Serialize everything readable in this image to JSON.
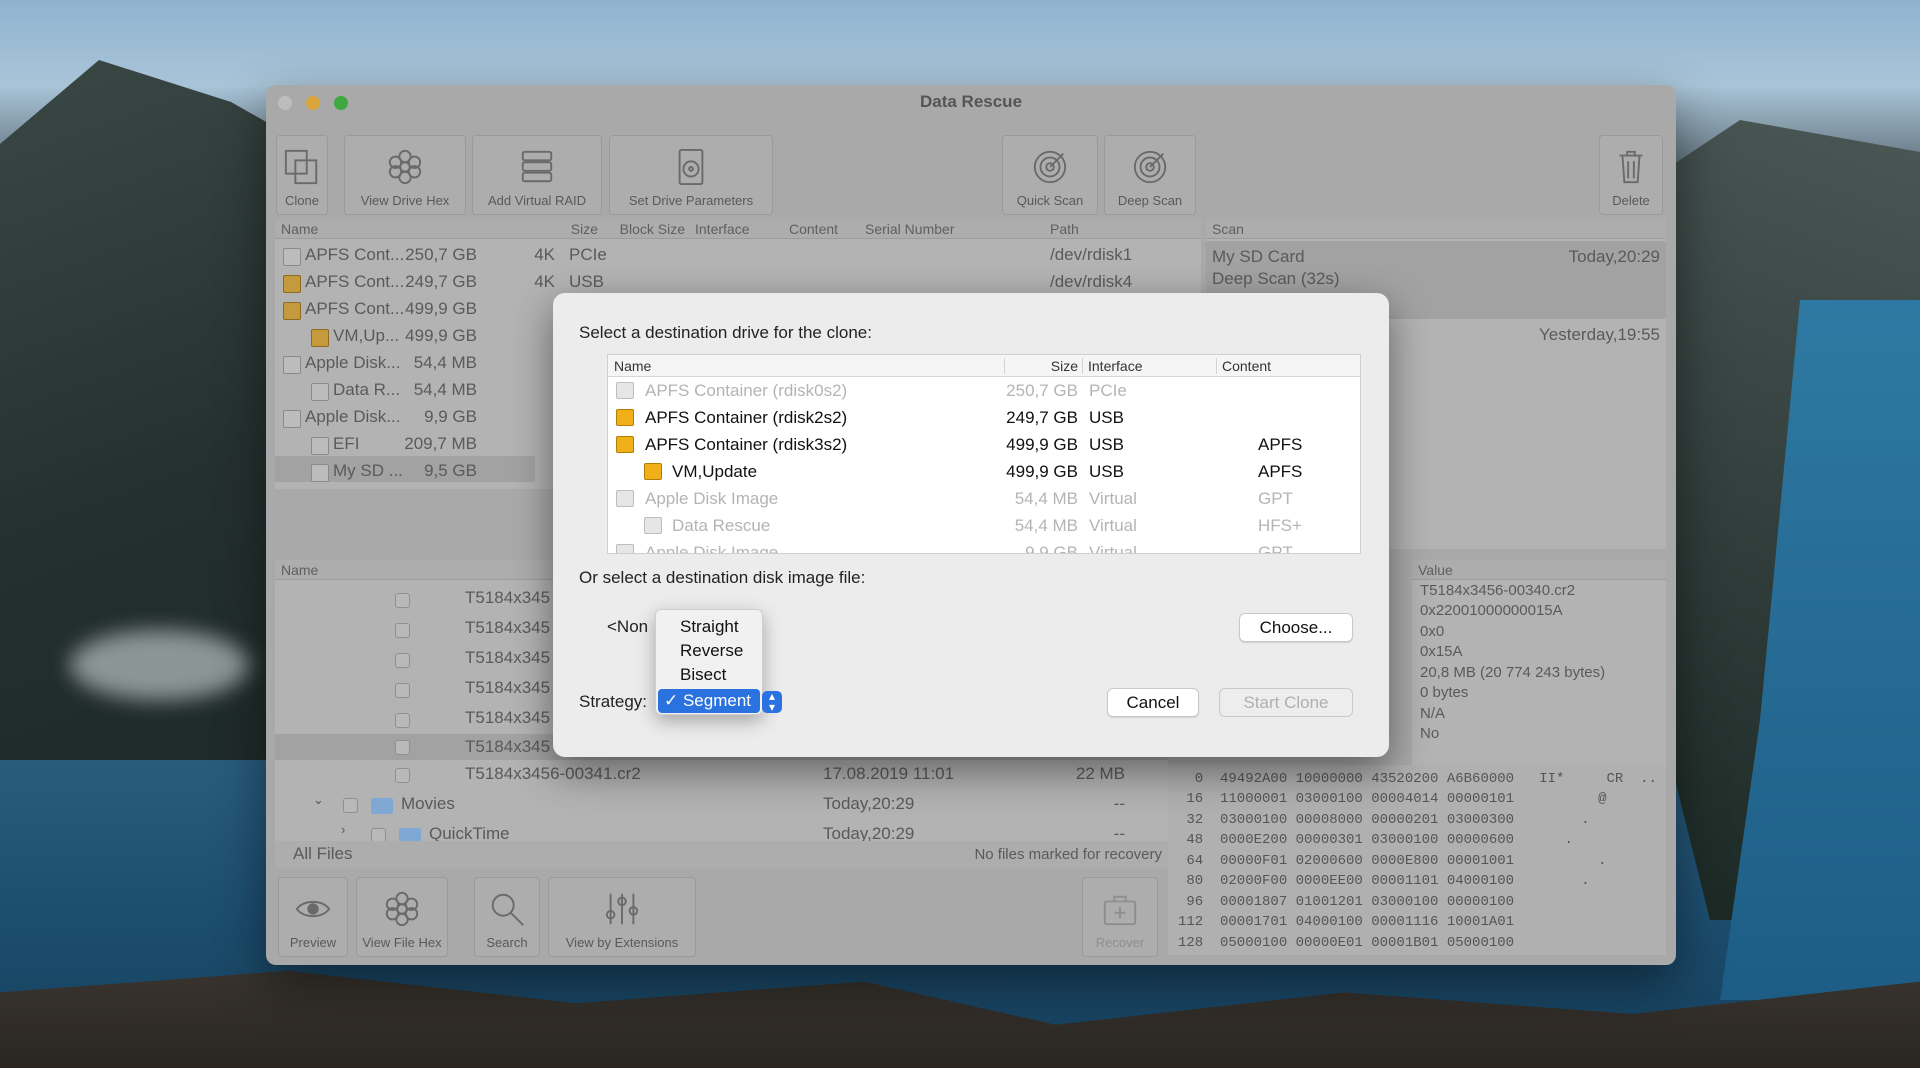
{
  "window": {
    "title": "Data Rescue"
  },
  "toolbar": {
    "clone": "Clone",
    "view_drive_hex": "View Drive Hex",
    "add_virtual_raid": "Add Virtual RAID",
    "set_drive_parameters": "Set Drive Parameters",
    "quick_scan": "Quick Scan",
    "deep_scan": "Deep Scan",
    "delete": "Delete"
  },
  "drives": {
    "headers": {
      "name": "Name",
      "size": "Size",
      "block_size": "Block Size",
      "interface": "Interface",
      "content": "Content",
      "serial": "Serial Number",
      "path": "Path"
    },
    "rows": [
      {
        "name": "APFS Cont...",
        "size": "250,7 GB",
        "block": "4K",
        "interface": "PCIe",
        "path": "/dev/rdisk1"
      },
      {
        "name": "APFS Cont...",
        "size": "249,7 GB",
        "block": "4K",
        "interface": "USB",
        "path": "/dev/rdisk4"
      },
      {
        "name": "APFS Cont...",
        "size": "499,9 GB",
        "block": "",
        "interface": "",
        "path": ""
      },
      {
        "name": "VM,Up...",
        "size": "499,9 GB",
        "block": "",
        "interface": "",
        "path": ""
      },
      {
        "name": "Apple Disk...",
        "size": "54,4 MB",
        "block": "",
        "interface": "",
        "path": ""
      },
      {
        "name": "Data R...",
        "size": "54,4 MB",
        "block": "",
        "interface": "",
        "path": ""
      },
      {
        "name": "Apple Disk...",
        "size": "9,9 GB",
        "block": "",
        "interface": "",
        "path": ""
      },
      {
        "name": "EFI",
        "size": "209,7 MB",
        "block": "",
        "interface": "",
        "path": ""
      },
      {
        "name": "My SD ...",
        "size": "9,5 GB",
        "block": "",
        "interface": "",
        "path": ""
      }
    ]
  },
  "scans": {
    "header": "Scan",
    "items": [
      {
        "title": "My SD Card",
        "subtitle": "Deep Scan (32s)",
        "time": "Today,20:29"
      },
      {
        "title": "",
        "subtitle": "",
        "time": "Yesterday,19:55"
      }
    ]
  },
  "files": {
    "header_name": "Name",
    "rows": [
      {
        "name": "T5184x345"
      },
      {
        "name": "T5184x345"
      },
      {
        "name": "T5184x345"
      },
      {
        "name": "T5184x345"
      },
      {
        "name": "T5184x345"
      },
      {
        "name": "T5184x345"
      }
    ],
    "full_row": {
      "name": "T5184x3456-00341.cr2",
      "date": "17.08.2019 11:01",
      "size": "22 MB"
    },
    "folders": [
      {
        "name": "Movies",
        "date": "Today,20:29",
        "size": "--"
      },
      {
        "name": "QuickTime",
        "date": "Today,20:29",
        "size": "--"
      }
    ],
    "all_files": "All Files",
    "status": "No files marked for recovery"
  },
  "info": {
    "header": "Value",
    "values": [
      "T5184x3456-00340.cr2",
      "0x22001000000015A",
      "0x0",
      "0x15A",
      "20,8 MB (20 774 243 bytes)",
      "0 bytes",
      "N/A",
      "No"
    ]
  },
  "hex": {
    "lines": [
      "  0  49492A00 10000000 43520200 A6B60000   II*     CR  ..",
      " 16  11000001 03000100 00004014 00000101          @",
      " 32  03000100 00008000 00000201 03000300        .",
      " 48  0000E200 00000301 03000100 00000600      .",
      " 64  00000F01 02000600 0000E800 00001001          .",
      " 80  02000F00 0000EE00 00001101 04000100        .",
      " 96  00001807 01001201 03000100 00000100",
      "112  00001701 04000100 00001116 10001A01",
      "128  05000100 00000E01 00001B01 05000100"
    ]
  },
  "bottom_toolbar": {
    "preview": "Preview",
    "view_file_hex": "View File Hex",
    "search": "Search",
    "view_by_extensions": "View by Extensions",
    "recover": "Recover"
  },
  "dialog": {
    "prompt": "Select a destination drive for the clone:",
    "headers": {
      "name": "Name",
      "size": "Size",
      "interface": "Interface",
      "content": "Content"
    },
    "rows": [
      {
        "name": "APFS Container (rdisk0s2)",
        "size": "250,7 GB",
        "interface": "PCIe",
        "content": ""
      },
      {
        "name": "APFS Container (rdisk2s2)",
        "size": "249,7 GB",
        "interface": "USB",
        "content": ""
      },
      {
        "name": "APFS Container (rdisk3s2)",
        "size": "499,9 GB",
        "interface": "USB",
        "content": "APFS"
      },
      {
        "name": "VM,Update",
        "size": "499,9 GB",
        "interface": "USB",
        "content": "APFS"
      },
      {
        "name": "Apple Disk Image",
        "size": "54,4 MB",
        "interface": "Virtual",
        "content": "GPT"
      },
      {
        "name": "Data Rescue",
        "size": "54,4 MB",
        "interface": "Virtual",
        "content": "HFS+"
      },
      {
        "name": "Apple Disk Image",
        "size": "9,9 GB",
        "interface": "Virtual",
        "content": "GPT"
      }
    ],
    "image_prompt": "Or select a destination disk image file:",
    "none_value": "<Non",
    "choose": "Choose...",
    "strategy_label": "Strategy:",
    "strategy_options": [
      "Straight",
      "Reverse",
      "Bisect",
      "Segment"
    ],
    "strategy_selected": "✓ Segment",
    "cancel": "Cancel",
    "start_clone": "Start Clone"
  }
}
